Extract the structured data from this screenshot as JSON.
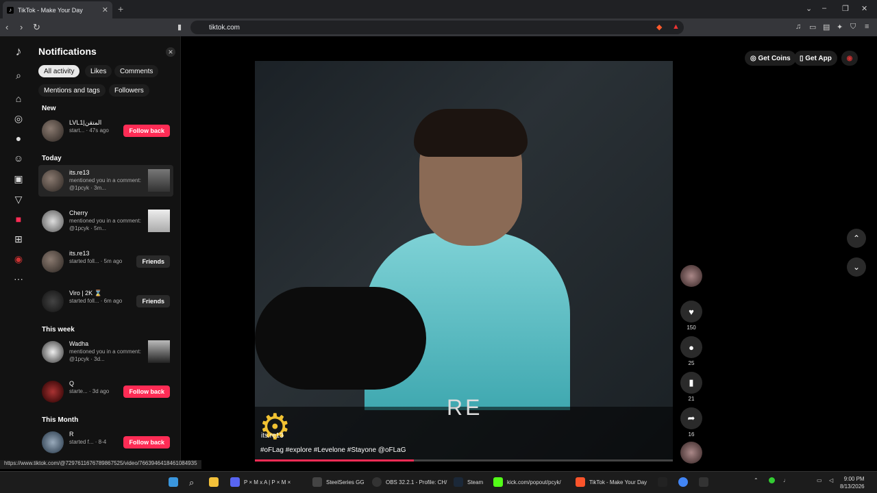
{
  "browser": {
    "tab_title": "TikTok - Make Your Day",
    "tab_close": "✕",
    "new_tab": "+",
    "url": "tiktok.com"
  },
  "notifications": {
    "title": "Notifications",
    "filters": [
      "All activity",
      "Likes",
      "Comments",
      "Mentions and tags",
      "Followers"
    ],
    "sections": {
      "new": "New",
      "today": "Today",
      "this_week": "This week",
      "this_month": "This Month"
    },
    "items": [
      {
        "name": "LVL1|المتقن",
        "text": "start... · 47s ago",
        "action": "Follow back"
      },
      {
        "name": "its.re13",
        "text": "mentioned you in a comment: @1pcyk · 3m...",
        "action": ""
      },
      {
        "name": "Cherry",
        "text": "mentioned you in a comment: @1pcyk · 5m...",
        "action": ""
      },
      {
        "name": "its.re13",
        "text": "started foll... · 5m ago",
        "action": "Friends"
      },
      {
        "name": "Viro | 2K ⌛",
        "text": "started foll... · 6m ago",
        "action": "Friends"
      },
      {
        "name": "Wadha",
        "text": "mentioned you in a comment: @1pcyk · 3d...",
        "action": ""
      },
      {
        "name": "Q",
        "text": "starte... · 3d ago",
        "action": "Follow back"
      },
      {
        "name": "R",
        "text": "started f... · 8-4",
        "action": "Follow back"
      }
    ]
  },
  "video": {
    "overlay_text": "RE",
    "watermark": "its.re13",
    "hashtags": "#oFLag #explore #Levelone #Stayone @oFLaG",
    "progress": 0.38
  },
  "actions": {
    "likes": "150",
    "comments": "25",
    "saves": "21",
    "shares": "16"
  },
  "top_right": {
    "get_coins": "Get Coins",
    "get_app": "Get App"
  },
  "status_url": "https://www.tiktok.com/@7297611676789867525/video/7663946418461084935",
  "taskbar": {
    "items": [
      "P × M x A | P × M ×",
      "SteelSeries GG",
      "OBS 32.2.1 - Profile: CH/",
      "Steam",
      "kick.com/popout/pcyk/",
      "TikTok - Make Your Day"
    ],
    "time": "9:00 PM",
    "date": "8/13/2026"
  },
  "colors": {
    "accent": "#fe2c55",
    "panel": "#121212"
  }
}
